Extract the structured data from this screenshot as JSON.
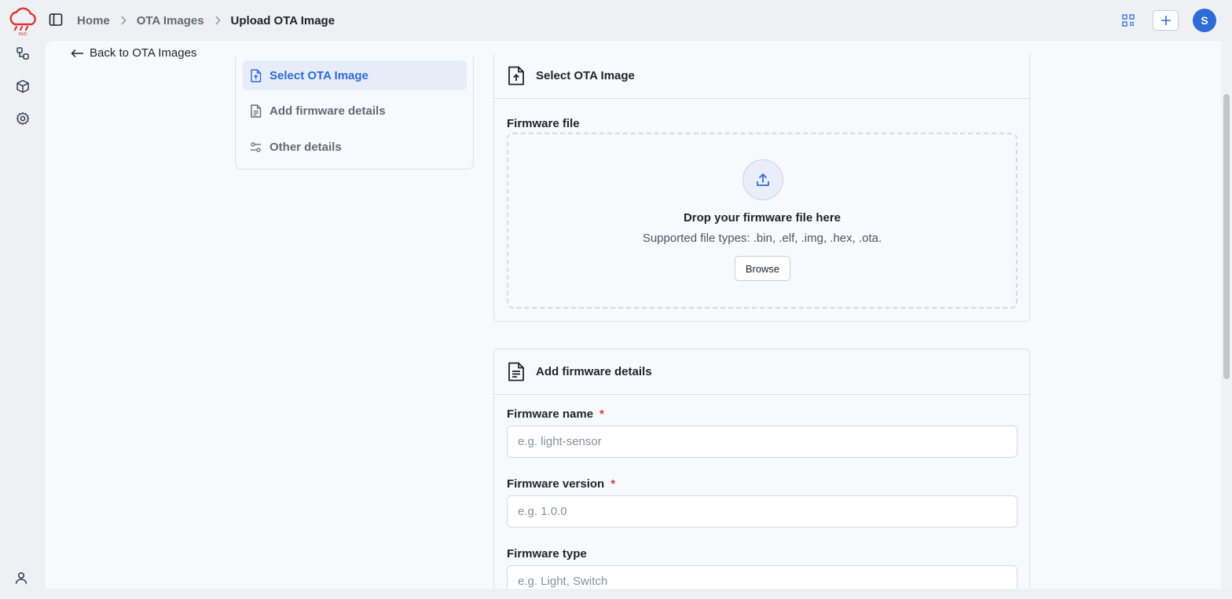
{
  "breadcrumb": {
    "home": "Home",
    "ota_images": "OTA Images",
    "current": "Upload OTA Image"
  },
  "user": {
    "initial": "S"
  },
  "logo": {
    "text": "RED"
  },
  "back_link": "Back to OTA Images",
  "steps": [
    {
      "label": "Select OTA Image",
      "icon": "file-upload-icon",
      "active": true
    },
    {
      "label": "Add firmware details",
      "icon": "document-icon",
      "active": false
    },
    {
      "label": "Other details",
      "icon": "sliders-icon",
      "active": false
    }
  ],
  "select_card": {
    "title": "Select OTA Image",
    "field_label": "Firmware file",
    "drop_title": "Drop your firmware file here",
    "drop_subtitle": "Supported file types: .bin, .elf, .img, .hex, .ota.",
    "browse_label": "Browse"
  },
  "details_card": {
    "title": "Add firmware details",
    "name_label": "Firmware name",
    "name_placeholder": "e.g. light-sensor",
    "version_label": "Firmware version",
    "version_placeholder": "e.g. 1.0.0",
    "type_label": "Firmware type",
    "type_placeholder": "e.g. Light, Switch",
    "required_mark": "*"
  },
  "colors": {
    "accent": "#2f6bd6",
    "brand_red": "#d83931",
    "background": "#eef0f4",
    "panel": "#f8f9fc"
  }
}
